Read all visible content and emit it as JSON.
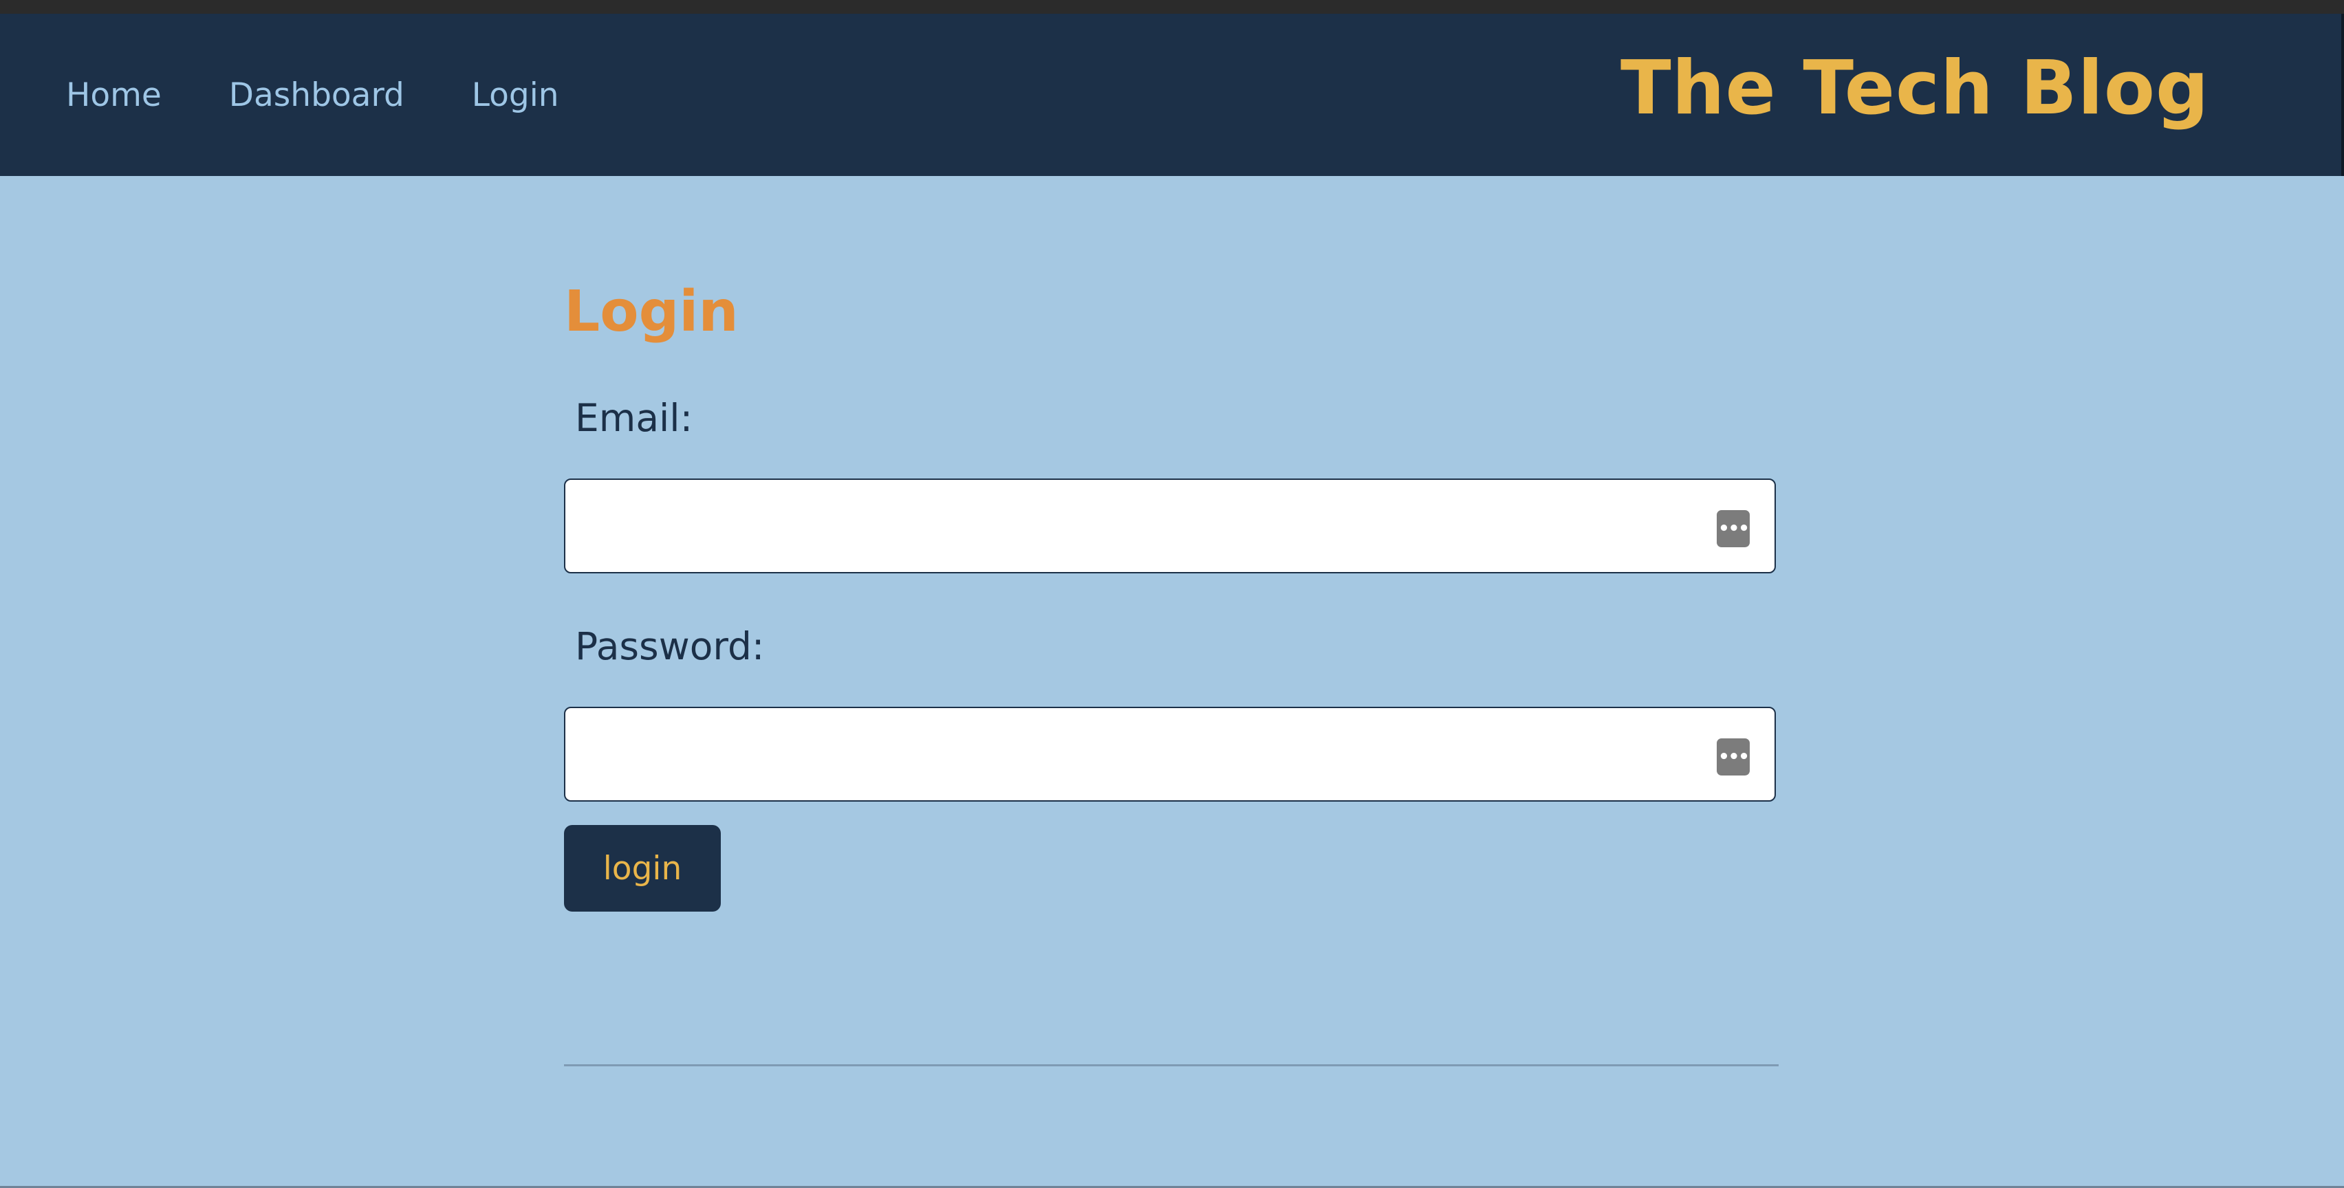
{
  "header": {
    "nav": [
      {
        "label": "Home"
      },
      {
        "label": "Dashboard"
      },
      {
        "label": "Login"
      }
    ],
    "brand": "The Tech Blog"
  },
  "login_form": {
    "title": "Login",
    "email_label": "Email:",
    "email_value": "",
    "password_label": "Password:",
    "password_value": "",
    "submit_label": "login",
    "password_manager_icon": "password-dots-icon"
  },
  "colors": {
    "header_bg": "#1c3048",
    "page_bg": "#a5c8e2",
    "nav_text": "#9ec6e6",
    "brand": "#e9b54a",
    "title": "#e48e3a",
    "button_bg": "#1c3048",
    "button_text": "#e9b54a"
  }
}
